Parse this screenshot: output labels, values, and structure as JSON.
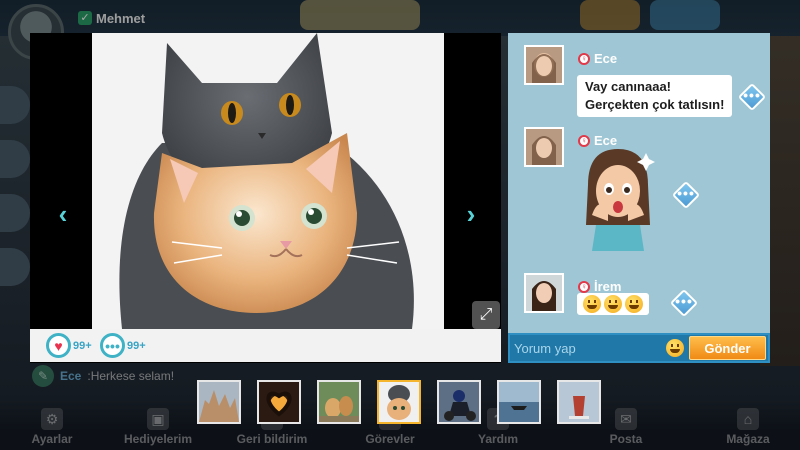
{
  "app": {
    "username": "Mehmet",
    "background_chat": {
      "name": "Ece",
      "text": "Herkese selam!"
    }
  },
  "bottom_nav": [
    {
      "label": "Ayarlar",
      "icon": "gear-icon"
    },
    {
      "label": "Hediyelerim",
      "icon": "gift-icon"
    },
    {
      "label": "Geri bildirim",
      "icon": "feedback-icon"
    },
    {
      "label": "Görevler",
      "icon": "tasks-icon"
    },
    {
      "label": "Yardım",
      "icon": "help-icon"
    },
    {
      "label": "Posta",
      "icon": "mail-icon"
    },
    {
      "label": "Mağaza",
      "icon": "shop-icon"
    }
  ],
  "viewer": {
    "likes": "99+",
    "comments_count": "99+",
    "photo_subject": "two-cats-photo"
  },
  "comments": [
    {
      "name": "Ece",
      "gender": "female",
      "type": "text",
      "lines": [
        "Vay canınaaa!",
        "Gerçekten çok tatlısın!"
      ]
    },
    {
      "name": "Ece",
      "gender": "female",
      "type": "sticker"
    },
    {
      "name": "İrem",
      "gender": "female",
      "type": "emoji",
      "count": 3
    }
  ],
  "input": {
    "placeholder": "Yorum yap",
    "send_label": "Gönder"
  },
  "thumbnails": [
    {
      "name": "thumb-rock-formations",
      "active": false
    },
    {
      "name": "thumb-heart-sunset",
      "active": false
    },
    {
      "name": "thumb-dogs",
      "active": false
    },
    {
      "name": "thumb-cats",
      "active": true
    },
    {
      "name": "thumb-motorcycle",
      "active": false
    },
    {
      "name": "thumb-boat",
      "active": false
    },
    {
      "name": "thumb-tea",
      "active": false
    }
  ],
  "colors": {
    "accent": "#3fb2c6",
    "comment_panel": "#9ec6d4",
    "send_button": "#f08a16",
    "active_thumb_border": "#f5b52c"
  }
}
